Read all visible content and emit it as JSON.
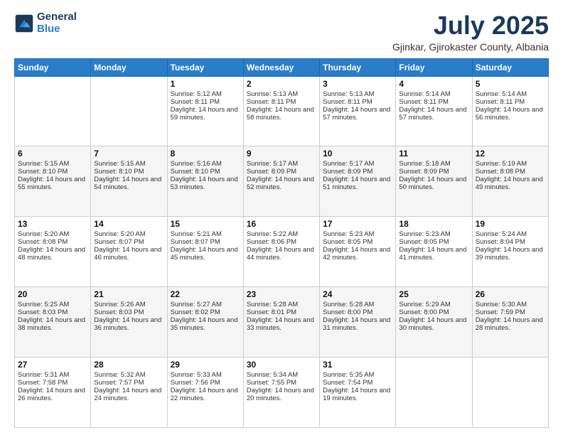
{
  "logo": {
    "general": "General",
    "blue": "Blue"
  },
  "title": "July 2025",
  "subtitle": "Gjinkar, Gjirokaster County, Albania",
  "days_header": [
    "Sunday",
    "Monday",
    "Tuesday",
    "Wednesday",
    "Thursday",
    "Friday",
    "Saturday"
  ],
  "weeks": [
    [
      {
        "day": "",
        "sunrise": "",
        "sunset": "",
        "daylight": ""
      },
      {
        "day": "",
        "sunrise": "",
        "sunset": "",
        "daylight": ""
      },
      {
        "day": "1",
        "sunrise": "Sunrise: 5:12 AM",
        "sunset": "Sunset: 8:11 PM",
        "daylight": "Daylight: 14 hours and 59 minutes."
      },
      {
        "day": "2",
        "sunrise": "Sunrise: 5:13 AM",
        "sunset": "Sunset: 8:11 PM",
        "daylight": "Daylight: 14 hours and 58 minutes."
      },
      {
        "day": "3",
        "sunrise": "Sunrise: 5:13 AM",
        "sunset": "Sunset: 8:11 PM",
        "daylight": "Daylight: 14 hours and 57 minutes."
      },
      {
        "day": "4",
        "sunrise": "Sunrise: 5:14 AM",
        "sunset": "Sunset: 8:11 PM",
        "daylight": "Daylight: 14 hours and 57 minutes."
      },
      {
        "day": "5",
        "sunrise": "Sunrise: 5:14 AM",
        "sunset": "Sunset: 8:11 PM",
        "daylight": "Daylight: 14 hours and 56 minutes."
      }
    ],
    [
      {
        "day": "6",
        "sunrise": "Sunrise: 5:15 AM",
        "sunset": "Sunset: 8:10 PM",
        "daylight": "Daylight: 14 hours and 55 minutes."
      },
      {
        "day": "7",
        "sunrise": "Sunrise: 5:15 AM",
        "sunset": "Sunset: 8:10 PM",
        "daylight": "Daylight: 14 hours and 54 minutes."
      },
      {
        "day": "8",
        "sunrise": "Sunrise: 5:16 AM",
        "sunset": "Sunset: 8:10 PM",
        "daylight": "Daylight: 14 hours and 53 minutes."
      },
      {
        "day": "9",
        "sunrise": "Sunrise: 5:17 AM",
        "sunset": "Sunset: 8:09 PM",
        "daylight": "Daylight: 14 hours and 52 minutes."
      },
      {
        "day": "10",
        "sunrise": "Sunrise: 5:17 AM",
        "sunset": "Sunset: 8:09 PM",
        "daylight": "Daylight: 14 hours and 51 minutes."
      },
      {
        "day": "11",
        "sunrise": "Sunrise: 5:18 AM",
        "sunset": "Sunset: 8:09 PM",
        "daylight": "Daylight: 14 hours and 50 minutes."
      },
      {
        "day": "12",
        "sunrise": "Sunrise: 5:19 AM",
        "sunset": "Sunset: 8:08 PM",
        "daylight": "Daylight: 14 hours and 49 minutes."
      }
    ],
    [
      {
        "day": "13",
        "sunrise": "Sunrise: 5:20 AM",
        "sunset": "Sunset: 8:08 PM",
        "daylight": "Daylight: 14 hours and 48 minutes."
      },
      {
        "day": "14",
        "sunrise": "Sunrise: 5:20 AM",
        "sunset": "Sunset: 8:07 PM",
        "daylight": "Daylight: 14 hours and 46 minutes."
      },
      {
        "day": "15",
        "sunrise": "Sunrise: 5:21 AM",
        "sunset": "Sunset: 8:07 PM",
        "daylight": "Daylight: 14 hours and 45 minutes."
      },
      {
        "day": "16",
        "sunrise": "Sunrise: 5:22 AM",
        "sunset": "Sunset: 8:06 PM",
        "daylight": "Daylight: 14 hours and 44 minutes."
      },
      {
        "day": "17",
        "sunrise": "Sunrise: 5:23 AM",
        "sunset": "Sunset: 8:05 PM",
        "daylight": "Daylight: 14 hours and 42 minutes."
      },
      {
        "day": "18",
        "sunrise": "Sunrise: 5:23 AM",
        "sunset": "Sunset: 8:05 PM",
        "daylight": "Daylight: 14 hours and 41 minutes."
      },
      {
        "day": "19",
        "sunrise": "Sunrise: 5:24 AM",
        "sunset": "Sunset: 8:04 PM",
        "daylight": "Daylight: 14 hours and 39 minutes."
      }
    ],
    [
      {
        "day": "20",
        "sunrise": "Sunrise: 5:25 AM",
        "sunset": "Sunset: 8:03 PM",
        "daylight": "Daylight: 14 hours and 38 minutes."
      },
      {
        "day": "21",
        "sunrise": "Sunrise: 5:26 AM",
        "sunset": "Sunset: 8:03 PM",
        "daylight": "Daylight: 14 hours and 36 minutes."
      },
      {
        "day": "22",
        "sunrise": "Sunrise: 5:27 AM",
        "sunset": "Sunset: 8:02 PM",
        "daylight": "Daylight: 14 hours and 35 minutes."
      },
      {
        "day": "23",
        "sunrise": "Sunrise: 5:28 AM",
        "sunset": "Sunset: 8:01 PM",
        "daylight": "Daylight: 14 hours and 33 minutes."
      },
      {
        "day": "24",
        "sunrise": "Sunrise: 5:28 AM",
        "sunset": "Sunset: 8:00 PM",
        "daylight": "Daylight: 14 hours and 31 minutes."
      },
      {
        "day": "25",
        "sunrise": "Sunrise: 5:29 AM",
        "sunset": "Sunset: 8:00 PM",
        "daylight": "Daylight: 14 hours and 30 minutes."
      },
      {
        "day": "26",
        "sunrise": "Sunrise: 5:30 AM",
        "sunset": "Sunset: 7:59 PM",
        "daylight": "Daylight: 14 hours and 28 minutes."
      }
    ],
    [
      {
        "day": "27",
        "sunrise": "Sunrise: 5:31 AM",
        "sunset": "Sunset: 7:58 PM",
        "daylight": "Daylight: 14 hours and 26 minutes."
      },
      {
        "day": "28",
        "sunrise": "Sunrise: 5:32 AM",
        "sunset": "Sunset: 7:57 PM",
        "daylight": "Daylight: 14 hours and 24 minutes."
      },
      {
        "day": "29",
        "sunrise": "Sunrise: 5:33 AM",
        "sunset": "Sunset: 7:56 PM",
        "daylight": "Daylight: 14 hours and 22 minutes."
      },
      {
        "day": "30",
        "sunrise": "Sunrise: 5:34 AM",
        "sunset": "Sunset: 7:55 PM",
        "daylight": "Daylight: 14 hours and 20 minutes."
      },
      {
        "day": "31",
        "sunrise": "Sunrise: 5:35 AM",
        "sunset": "Sunset: 7:54 PM",
        "daylight": "Daylight: 14 hours and 19 minutes."
      },
      {
        "day": "",
        "sunrise": "",
        "sunset": "",
        "daylight": ""
      },
      {
        "day": "",
        "sunrise": "",
        "sunset": "",
        "daylight": ""
      }
    ]
  ]
}
